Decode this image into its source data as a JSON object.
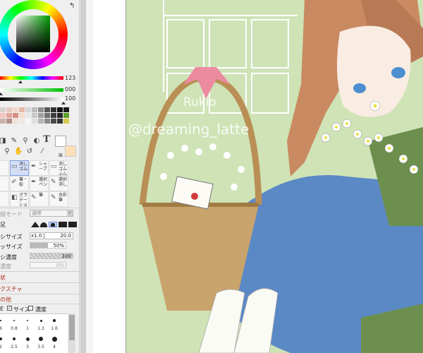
{
  "color_panel": {
    "slider_values": [
      "123",
      "000",
      "100"
    ]
  },
  "brush_cells": [
    {
      "label": "",
      "selected": false
    },
    {
      "label": "消しゴム",
      "selected": true
    },
    {
      "label": "シャープ",
      "selected": false
    },
    {
      "label": "消しゴム ふんわり",
      "selected": false
    },
    {
      "label": "",
      "selected": false
    },
    {
      "label": "筆・絵",
      "selected": false
    },
    {
      "label": "選択ペン",
      "selected": false
    },
    {
      "label": "選択消し",
      "selected": false
    },
    {
      "label": "",
      "selected": false
    },
    {
      "label": "グラデー ション",
      "selected": false
    },
    {
      "label": "筆",
      "selected": false
    },
    {
      "label": "水彩筆",
      "selected": false
    }
  ],
  "brush_settings": {
    "blend_mode_label": "描モード",
    "blend_mode_value": "通常",
    "edge_label": "足",
    "size_label": "シサイズ",
    "size_multiplier": "x1.0",
    "size_value": "20.0",
    "min_size_label": "ッサイズ",
    "min_size_value": "50%",
    "density_label": "シ濃度",
    "density_value": "100",
    "min_density_label": "濃度",
    "min_density_value": "0%",
    "shape_label": "状",
    "texture_label": "クスチャ",
    "other_label": "の他",
    "pressure_label": "E",
    "pressure_size": "サイズ",
    "pressure_density": "濃度"
  },
  "brush_sizes": {
    "row1": [
      "6",
      "0.8",
      "1",
      "1.3",
      "1.6"
    ],
    "row2": [
      "2",
      "2.5",
      "3",
      "3.5",
      "4"
    ]
  },
  "canvas_text": {
    "signature": "Rukio",
    "handle": "@dreaming_latte"
  }
}
